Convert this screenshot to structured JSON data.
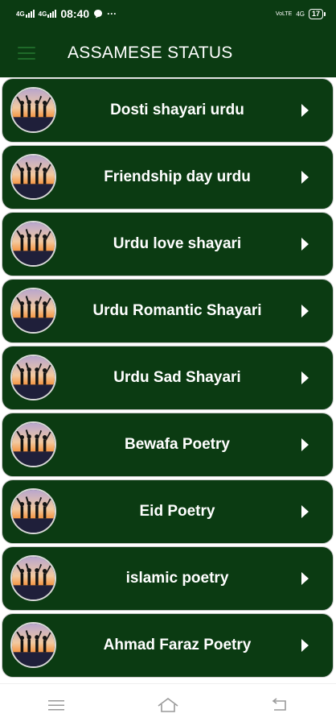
{
  "status_bar": {
    "signal1": "4G",
    "signal2": "4G",
    "time": "08:40",
    "extra": "···",
    "volte": "VoLTE",
    "network": "4G",
    "battery": "17"
  },
  "app_bar": {
    "title": "ASSAMESE STATUS",
    "menu_icon": "hamburger-menu-icon"
  },
  "list": {
    "items": [
      {
        "label": "Dosti shayari urdu"
      },
      {
        "label": "Friendship day urdu"
      },
      {
        "label": "Urdu love shayari"
      },
      {
        "label": "Urdu Romantic Shayari"
      },
      {
        "label": "Urdu Sad Shayari"
      },
      {
        "label": "Bewafa Poetry"
      },
      {
        "label": "Eid Poetry"
      },
      {
        "label": "islamic poetry"
      },
      {
        "label": "Ahmad Faraz Poetry"
      }
    ]
  },
  "nav_bar": {
    "icons": [
      "menu-icon",
      "home-icon",
      "back-icon"
    ]
  },
  "colors": {
    "primary_dark": "#0b3b12",
    "item_border": "#c9c9c9",
    "text": "#ffffff"
  }
}
